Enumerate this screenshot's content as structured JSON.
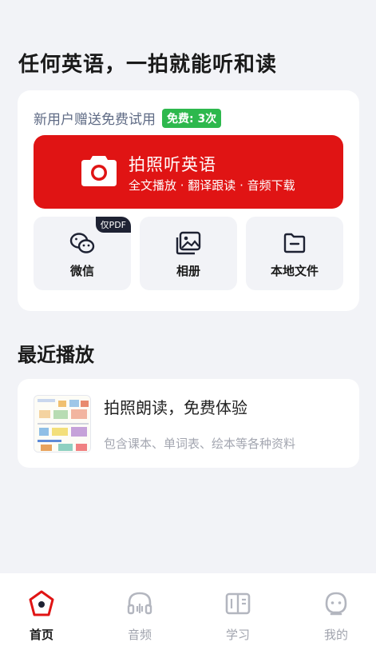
{
  "hero": {
    "title": "任何英语，一拍就能听和读"
  },
  "promo": {
    "text": "新用户赠送免费试用",
    "badge": "免费: 3次"
  },
  "camera_button": {
    "title": "拍照听英语",
    "subtitle": "全文播放 · 翻译跟读 · 音频下载",
    "color": "#e01414"
  },
  "tiles": [
    {
      "label": "微信",
      "badge": "仅PDF",
      "icon": "wechat-icon"
    },
    {
      "label": "相册",
      "icon": "album-icon"
    },
    {
      "label": "本地文件",
      "icon": "folder-icon"
    }
  ],
  "recent": {
    "section_title": "最近播放",
    "item": {
      "title": "拍照朗读，免费体验",
      "subtitle": "包含课本、单词表、绘本等各种资料"
    }
  },
  "tabbar": {
    "active": "首页",
    "accent": "#e01414",
    "items": [
      {
        "label": "首页",
        "icon": "home-icon"
      },
      {
        "label": "音频",
        "icon": "headphones-icon"
      },
      {
        "label": "学习",
        "icon": "book-icon"
      },
      {
        "label": "我的",
        "icon": "profile-icon"
      }
    ]
  }
}
